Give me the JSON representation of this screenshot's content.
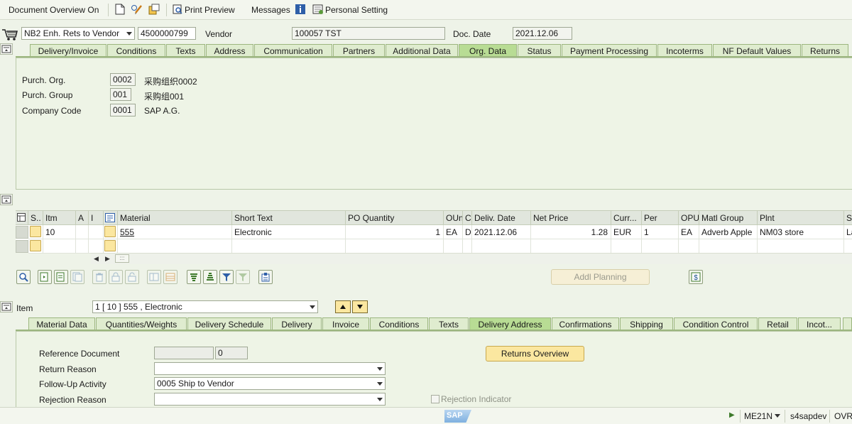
{
  "toolbar": {
    "doc_overview": "Document Overview On",
    "print_preview": "Print Preview",
    "messages": "Messages",
    "personal_setting": "Personal Setting"
  },
  "header": {
    "doc_type": "NB2 Enh. Rets to Vendor",
    "po_number": "4500000799",
    "vendor_label": "Vendor",
    "vendor_value": "100057 TST",
    "doc_date_label": "Doc. Date",
    "doc_date_value": "2021.12.06"
  },
  "header_tabs": [
    "Delivery/Invoice",
    "Conditions",
    "Texts",
    "Address",
    "Communication",
    "Partners",
    "Additional Data",
    "Org. Data",
    "Status",
    "Payment Processing",
    "Incoterms",
    "NF Default Values",
    "Returns"
  ],
  "org_data": {
    "purch_org_label": "Purch. Org.",
    "purch_org_value": "0002",
    "purch_org_desc": "采购组织0002",
    "purch_group_label": "Purch. Group",
    "purch_group_value": "001",
    "purch_group_desc": "采购组001",
    "company_code_label": "Company Code",
    "company_code_value": "0001",
    "company_code_desc": "SAP A.G."
  },
  "items_table": {
    "headers": [
      "S..",
      "Itm",
      "A",
      "I",
      "Material",
      "Short Text",
      "PO Quantity",
      "OUn",
      "C",
      "Deliv. Date",
      "Net Price",
      "Curr...",
      "Per",
      "OPU",
      "Matl Group",
      "Plnt",
      "S"
    ],
    "row": {
      "itm": "10",
      "material": "555",
      "short_text": "Electronic",
      "po_quantity": "1",
      "oun": "EA",
      "c": "D",
      "deliv_date": "2021.12.06",
      "net_price": "1.28",
      "curr": "EUR",
      "per": "1",
      "opu": "EA",
      "matl_group": "Adverb Apple",
      "plnt": "NM03 store",
      "s": "La"
    },
    "scroll_indicator": ":::"
  },
  "buttons": {
    "addl_planning": "Addl Planning",
    "returns_overview": "Returns Overview"
  },
  "item_detail": {
    "item_label": "Item",
    "item_value": "1 [ 10 ] 555 , Electronic",
    "tabs": [
      "Material Data",
      "Quantities/Weights",
      "Delivery Schedule",
      "Delivery",
      "Invoice",
      "Conditions",
      "Texts",
      "Delivery Address",
      "Confirmations",
      "Shipping",
      "Condition Control",
      "Retail",
      "Incot..."
    ],
    "reference_document_label": "Reference Document",
    "reference_document_value": "",
    "reference_document_item": "0",
    "return_reason_label": "Return Reason",
    "return_reason_value": "",
    "followup_label": "Follow-Up Activity",
    "followup_value": "0005 Ship to Vendor",
    "rejection_reason_label": "Rejection Reason",
    "rejection_reason_value": "",
    "rejection_indicator_label": "Rejection Indicator"
  },
  "statusbar": {
    "sap_logo": "SAP",
    "transaction": "ME21N",
    "system": "s4sapdev",
    "mode": "OVR"
  },
  "colors": {
    "active_tab": "#b8dc94",
    "tab": "#dfeccf",
    "button_yellow": "#fbe7a0",
    "background": "#eef3e8"
  }
}
